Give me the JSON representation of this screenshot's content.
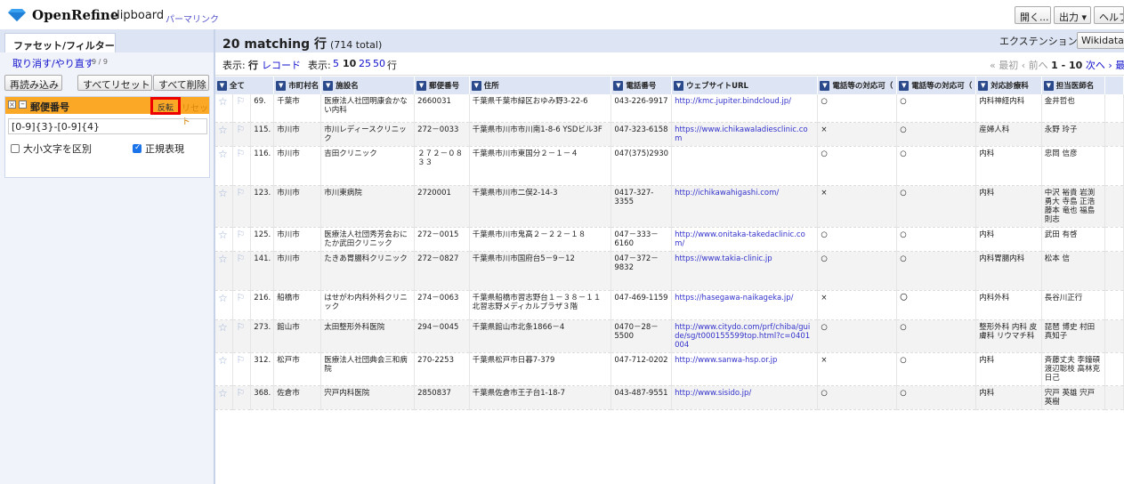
{
  "header": {
    "brand": "OpenRefine",
    "project_name": "clipboard",
    "permalink": "パーマリンク",
    "open_button": "開く...",
    "export_button": "出力 ▾",
    "help_button": "ヘルプ"
  },
  "left_panel": {
    "tab_label": "ファセット/フィルター",
    "undo_redo": "取り消す/やり直す",
    "undo_count": "9 / 9",
    "refresh_button": "再読み込み",
    "reset_all_button": "すべてリセット",
    "remove_all_button": "すべて削除",
    "facet": {
      "title": "郵便番号",
      "invert_label": "反転",
      "reset_label": "リセット",
      "expression": "[0-9]{3}-[0-9]{4}",
      "case_sensitive_label": "大小文字を区別",
      "regex_label": "正規表現",
      "case_sensitive_checked": false,
      "regex_checked": true
    }
  },
  "summary": {
    "matching": "20 matching 行",
    "total": "(714 total)",
    "extensions_label": "エクステンション:",
    "extensions_value": "Wikidata ▾"
  },
  "viewbar": {
    "show_label": "表示:",
    "rows_label": "行",
    "records_label": "レコード",
    "show2_label": "表示:",
    "size_5": "5",
    "size_10": "10",
    "size_25": "25",
    "size_50": "50",
    "size_unit": "行",
    "first": "« 最初",
    "prev": "‹ 前へ",
    "range": "1 - 10",
    "next": "次へ ›",
    "last": "最後 »"
  },
  "table": {
    "all_label": "全て",
    "columns": [
      "市町村名",
      "施設名",
      "郵便番号",
      "住所",
      "電話番号",
      "ウェブサイトURL",
      "電話等の対応可（",
      "電話等の対応可（",
      "対応診療科",
      "担当医師名"
    ],
    "rows": [
      {
        "num": "69.",
        "city": "千葉市",
        "name": "医療法人社団明康会かない内科",
        "zip": "2660031",
        "address": "千葉県千葉市緑区おゆみ野3-22-6",
        "phone": "043-226-9917",
        "url": "http://kmc.jupiter.bindcloud.jp/",
        "c1": "○",
        "c2": "○",
        "dept": "内科神経内科",
        "doctor": "金井哲也"
      },
      {
        "num": "115.",
        "city": "市川市",
        "name": "市川レディースクリニック",
        "zip": "272－0033",
        "address": "千葉県市川市市川南1-8-6 YSDビル3F",
        "phone": "047-323-6158",
        "url": "https://www.ichikawaladiesclinic.com",
        "c1": "×",
        "c2": "○",
        "dept": "産婦人科",
        "doctor": "永野 玲子"
      },
      {
        "num": "116.",
        "city": "市川市",
        "name": "吉田クリニック",
        "zip": "２７２－０８３３",
        "address": "千葉県市川市東国分２－１－４",
        "phone": "047(375)2930",
        "url": "",
        "c1": "○",
        "c2": "○",
        "dept": "内科",
        "doctor": "忠岡 信彦"
      },
      {
        "num": "123.",
        "city": "市川市",
        "name": "市川東病院",
        "zip": "2720001",
        "address": "千葉県市川市二俣2-14-3",
        "phone": "0417-327-3355",
        "url": "http://ichikawahigashi.com/",
        "c1": "×",
        "c2": "○",
        "dept": "内科",
        "doctor": "中沢 裕貴 岩渕 勇大 寺島 正浩 藤本 竜也 福島 則志"
      },
      {
        "num": "125.",
        "city": "市川市",
        "name": "医療法人社団秀芳会おにたか武田クリニック",
        "zip": "272－0015",
        "address": "千葉県市川市鬼高２－２２－１８",
        "phone": "047－333－6160",
        "url": "http://www.onitaka-takedaclinic.com/",
        "c1": "○",
        "c2": "○",
        "dept": "内科",
        "doctor": "武田 有啓"
      },
      {
        "num": "141.",
        "city": "市川市",
        "name": "たきあ胃腸科クリニック",
        "zip": "272－0827",
        "address": "千葉県市川市国府台5－9－12",
        "phone": "047－372－9832",
        "url": "https://www.takia-clinic.jp",
        "c1": "○",
        "c2": "○",
        "dept": "内科胃腸内科",
        "doctor": "松本 信"
      },
      {
        "num": "216.",
        "city": "船橋市",
        "name": "はせがわ内科外科クリニック",
        "zip": "274－0063",
        "address": "千葉県船橋市習志野台１－３８－１１ 北習志野メディカルプラザ３階",
        "phone": "047-469-1159",
        "url": "https://hasegawa-naikageka.jp/",
        "c1": "×",
        "c2": "〇",
        "dept": "内科外科",
        "doctor": "長谷川正行"
      },
      {
        "num": "273.",
        "city": "館山市",
        "name": "太田整形外科医院",
        "zip": "294－0045",
        "address": "千葉県館山市北条1866－4",
        "phone": "0470－28－5500",
        "url": "http://www.citydo.com/prf/chiba/guide/sg/t000155599top.html?c=0401004",
        "c1": "○",
        "c2": "○",
        "dept": "整形外科 内科 皮膚科 リウマチ科",
        "doctor": "琵琶 博史 村田 真知子"
      },
      {
        "num": "312.",
        "city": "松戸市",
        "name": "医療法人社団典会三和病院",
        "zip": "270-2253",
        "address": "千葉県松戸市日暮7-379",
        "phone": "047-712-0202",
        "url": "http://www.sanwa-hsp.or.jp",
        "c1": "×",
        "c2": "○",
        "dept": "内科",
        "doctor": "斉藤丈夫 李鐘碩 渡辺聡枝 高林克日己"
      },
      {
        "num": "368.",
        "city": "佐倉市",
        "name": "宍戸内科医院",
        "zip": "2850837",
        "address": "千葉県佐倉市王子台1-18-7",
        "phone": "043-487-9551",
        "url": "http://www.sisido.jp/",
        "c1": "○",
        "c2": "○",
        "dept": "内科",
        "doctor": "宍戸 英雄 宍戸 英樹"
      }
    ]
  }
}
